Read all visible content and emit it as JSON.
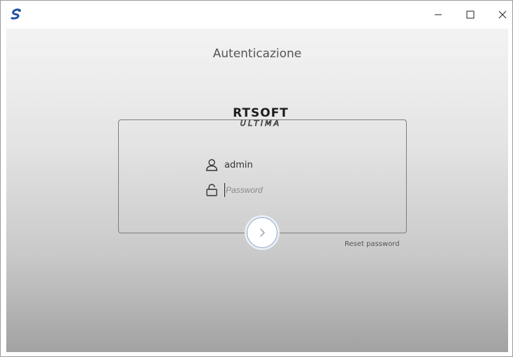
{
  "window": {
    "app_icon": "app-logo-icon",
    "controls": {
      "minimize_icon": "minimize-icon",
      "maximize_icon": "maximize-icon",
      "close_icon": "close-icon"
    }
  },
  "page": {
    "title": "Autenticazione"
  },
  "logo": {
    "line1": "RTSOFT",
    "line2": "ULTIMA"
  },
  "login": {
    "user_icon": "user-icon",
    "username": "admin",
    "password_icon": "lock-icon",
    "password_placeholder": "Password",
    "password_value": "",
    "submit_icon": "chevron-right-icon",
    "reset_label": "Reset password"
  },
  "colors": {
    "background_top": "#f3f3f3",
    "background_bottom": "#a2a2a2",
    "box_border": "#7d7d7d",
    "button_ring": "#8fa7c4"
  }
}
